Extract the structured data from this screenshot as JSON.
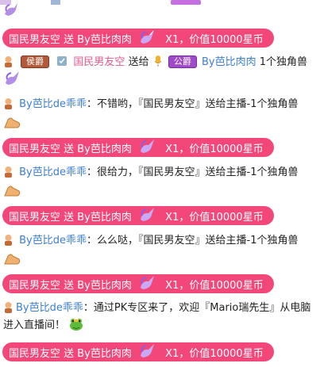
{
  "banner": {
    "text_left": "国民男友空 送 By芭比肉肉",
    "text_right": "X1，价值10000星币"
  },
  "row_gift_send": {
    "badge1": "侯爵",
    "sender": "国民男友空",
    "verb": "送给",
    "badge2": "公爵",
    "receiver": "By芭比肉肉",
    "amount": "1个独角兽"
  },
  "chat": [
    {
      "user": "By芭比de乖乖",
      "message": "不错哟，『国民男友空』送给主播-1个独角兽"
    },
    {
      "user": "By芭比de乖乖",
      "message": "很给力，『国民男友空』送给主播-1个独角兽"
    },
    {
      "user": "By芭比de乖乖",
      "message": "么么哒，『国民男友空』送给主播-1个独角兽"
    },
    {
      "user": "By芭比de乖乖",
      "message": "通过PK专区来了，欢迎『Mario瑞先生』从电脑进入直播间！"
    }
  ],
  "colors": {
    "banner": "#f3477a",
    "user_link": "#3c7fd1",
    "sender_pink": "#e05a8f"
  },
  "icons": [
    "unicorn-icon",
    "avatar-icon",
    "thumbs-up-icon",
    "frog-icon",
    "shield-icon",
    "microphone-icon"
  ]
}
